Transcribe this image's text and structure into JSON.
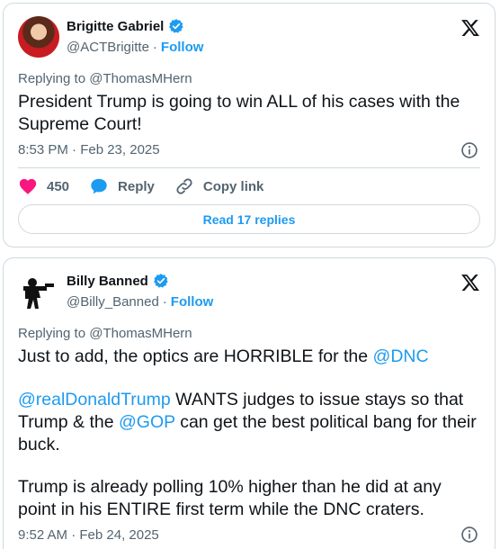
{
  "tweets": [
    {
      "author_name": "Brigitte Gabriel",
      "author_handle": "@ACTBrigitte",
      "separator": "·",
      "follow_label": "Follow",
      "replying_to": "Replying to @ThomasMHern",
      "text": "President Trump is going to win ALL of his cases with the Supreme Court!",
      "timestamp": "8:53 PM · Feb 23, 2025",
      "likes": "450",
      "reply_label": "Reply",
      "copy_link_label": "Copy link",
      "read_replies_label": "Read 17 replies"
    },
    {
      "author_name": "Billy Banned",
      "author_handle": "@Billy_Banned",
      "separator": "·",
      "follow_label": "Follow",
      "replying_to": "Replying to @ThomasMHern",
      "para1_text": "Just to add, the optics are HORRIBLE for the ",
      "para1_mention": "@DNC",
      "para2_mention1": "@realDonaldTrump",
      "para2_text1": " WANTS judges to issue stays so that Trump & the ",
      "para2_mention2": "@GOP",
      "para2_text2": " can get the best political bang for their buck.",
      "para3_text": "Trump is already polling 10% higher than he did at any point in his ENTIRE first term while the DNC craters.",
      "timestamp": "9:52 AM · Feb 24, 2025"
    }
  ],
  "colors": {
    "accent": "#1d9bf0",
    "like": "#f91880",
    "verified": "#1d9bf0",
    "muted": "#536471"
  }
}
